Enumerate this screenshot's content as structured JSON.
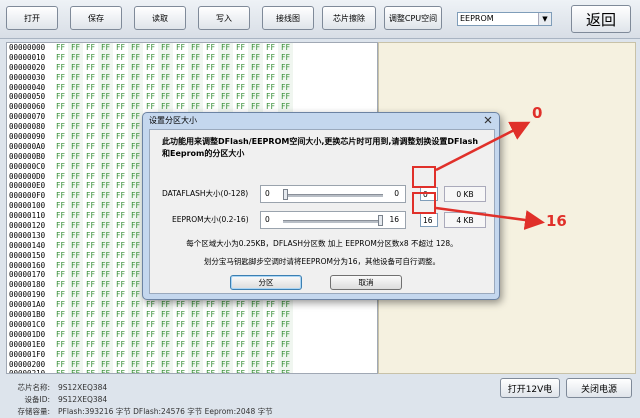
{
  "toolbar": {
    "open": "打开",
    "save": "保存",
    "read": "读取",
    "write": "写入",
    "wiring": "接线图",
    "erase": "芯片擦除",
    "adjust_cpu": "调整CPU空间",
    "memory_select": "EEPROM",
    "back": "返回"
  },
  "hex_addresses": [
    "00000000",
    "00000010",
    "00000020",
    "00000030",
    "00000040",
    "00000050",
    "00000060",
    "00000070",
    "00000080",
    "00000090",
    "000000A0",
    "000000B0",
    "000000C0",
    "000000D0",
    "000000E0",
    "000000F0",
    "00000100",
    "00000110",
    "00000120",
    "00000130",
    "00000140",
    "00000150",
    "00000160",
    "00000170",
    "00000180",
    "00000190",
    "000001A0",
    "000001B0",
    "000001C0",
    "000001D0",
    "000001E0",
    "000001F0",
    "00000200",
    "00000210",
    "00000220",
    "00000230",
    "00000240",
    "00000250",
    "00000260"
  ],
  "hex_byte": "FF",
  "dialog": {
    "title": "设置分区大小",
    "heading": "此功能用来调整DFlash/EEPROM空间大小,更换芯片时可用到,请调整划换设置DFlash和Eeprom的分区大小",
    "dflash_label": "DATAFLASH大小(0-128)",
    "dflash_min": "0",
    "dflash_value": "0",
    "dflash_box": "0",
    "dflash_kb": "0 KB",
    "dflash_level": 0,
    "eeprom_label": "EEPROM大小(0.2-16)",
    "eeprom_min": "0",
    "eeprom_value": "16",
    "eeprom_box": "16",
    "eeprom_kb": "4 KB",
    "eeprom_level": 1,
    "note1": "每个区域大小为0.25KB，DFLASH分区数 加上 EEPROM分区数x8 不超过 128。",
    "note2": "划分宝马钥匙脚步空调时请将EEPROM分为16，其他设备可自行调整。",
    "ok": "分区",
    "cancel": "取消"
  },
  "annotations": {
    "top": "0",
    "bottom": "16",
    "color": "#e0302a"
  },
  "status": {
    "chip_label": "芯片名称:",
    "chip_value": "9S12XEQ384",
    "device_label": "设备ID:",
    "device_value": "9S12XEQ384",
    "storage_label": "存储容量:",
    "storage_value": "PFlash:393216 字节 DFlash:24576 字节 Eeprom:2048 字节"
  },
  "buttons": {
    "open12v": "打开12V电",
    "close": "关闭电源"
  }
}
